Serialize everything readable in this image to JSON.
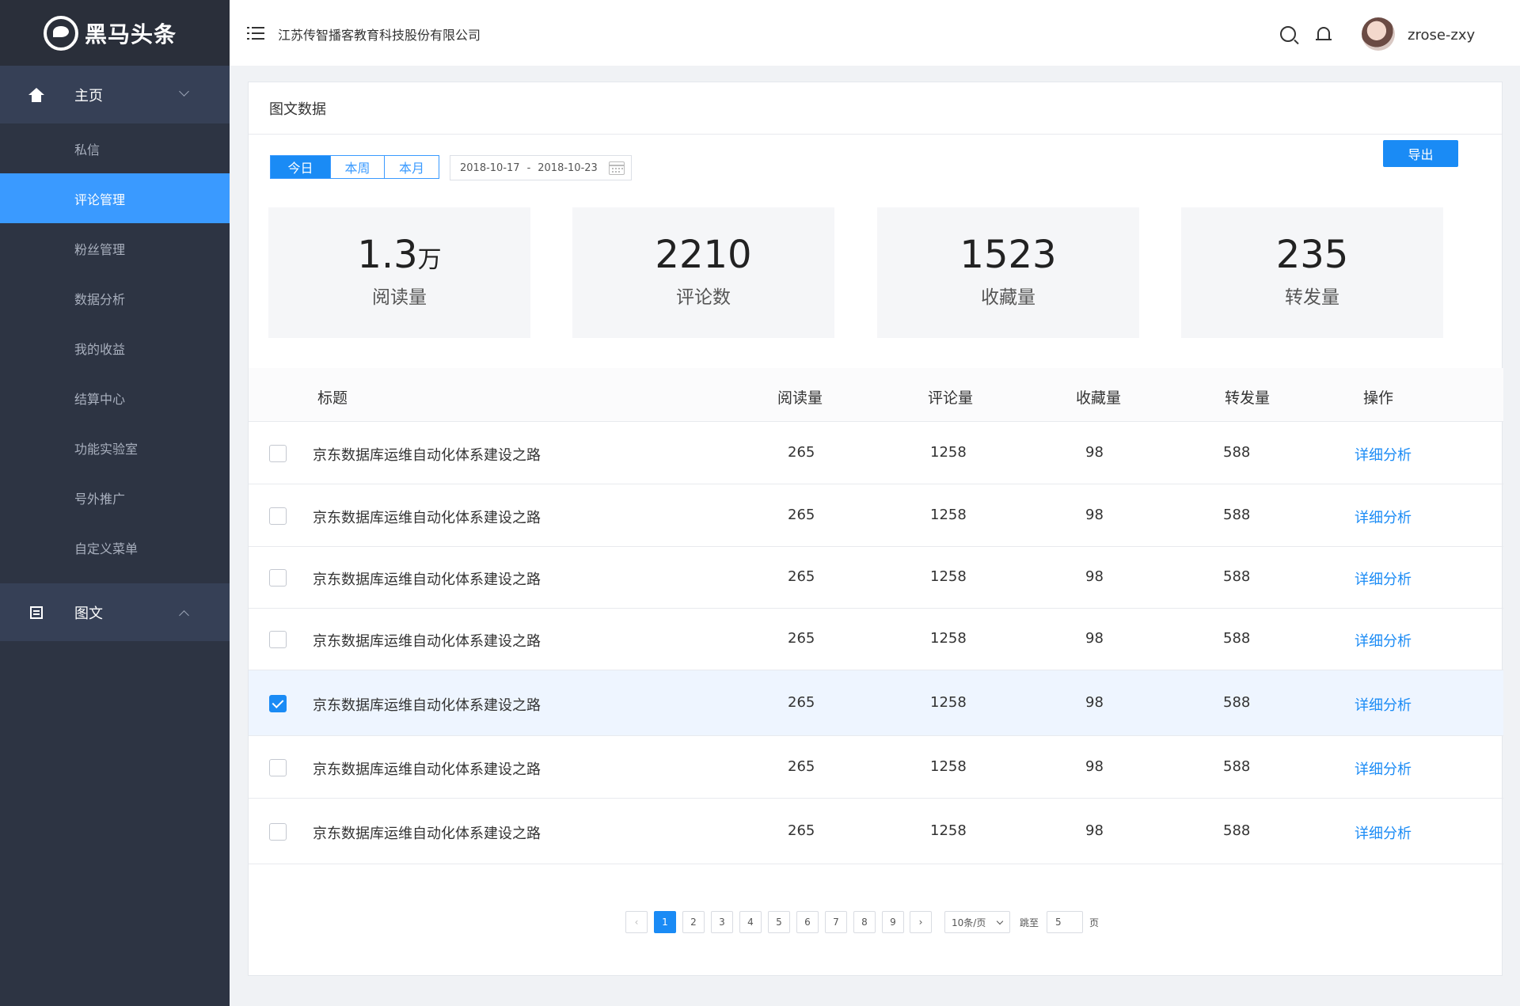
{
  "brand": {
    "name": "黑马头条"
  },
  "sidebar": {
    "home": {
      "label": "主页",
      "icon": "home-icon"
    },
    "items": [
      {
        "label": "私信"
      },
      {
        "label": "评论管理",
        "active": true
      },
      {
        "label": "粉丝管理"
      },
      {
        "label": "数据分析"
      },
      {
        "label": "我的收益"
      },
      {
        "label": "结算中心"
      },
      {
        "label": "功能实验室"
      },
      {
        "label": "号外推广"
      },
      {
        "label": "自定义菜单"
      }
    ],
    "tuwen": {
      "label": "图文",
      "icon": "document-icon"
    }
  },
  "header": {
    "company": "江苏传智播客教育科技股份有限公司",
    "username": "zrose-zxy"
  },
  "panel": {
    "title": "图文数据",
    "tabs": [
      "今日",
      "本周",
      "本月"
    ],
    "active_tab": "今日",
    "date_start": "2018-10-17",
    "date_sep": "-",
    "date_end": "2018-10-23",
    "export_label": "导出"
  },
  "stats": [
    {
      "value": "1.3",
      "unit": "万",
      "label": "阅读量"
    },
    {
      "value": "2210",
      "unit": "",
      "label": "评论数"
    },
    {
      "value": "1523",
      "unit": "",
      "label": "收藏量"
    },
    {
      "value": "235",
      "unit": "",
      "label": "转发量"
    }
  ],
  "table": {
    "columns": [
      "标题",
      "阅读量",
      "评论量",
      "收藏量",
      "转发量",
      "操作"
    ],
    "rows": [
      {
        "title": "京东数据库运维自动化体系建设之路",
        "reads": "265",
        "comments": "1258",
        "favorites": "98",
        "shares": "588",
        "action": "详细分析",
        "checked": false
      },
      {
        "title": "京东数据库运维自动化体系建设之路",
        "reads": "265",
        "comments": "1258",
        "favorites": "98",
        "shares": "588",
        "action": "详细分析",
        "checked": false
      },
      {
        "title": "京东数据库运维自动化体系建设之路",
        "reads": "265",
        "comments": "1258",
        "favorites": "98",
        "shares": "588",
        "action": "详细分析",
        "checked": false
      },
      {
        "title": "京东数据库运维自动化体系建设之路",
        "reads": "265",
        "comments": "1258",
        "favorites": "98",
        "shares": "588",
        "action": "详细分析",
        "checked": false
      },
      {
        "title": "京东数据库运维自动化体系建设之路",
        "reads": "265",
        "comments": "1258",
        "favorites": "98",
        "shares": "588",
        "action": "详细分析",
        "checked": true
      },
      {
        "title": "京东数据库运维自动化体系建设之路",
        "reads": "265",
        "comments": "1258",
        "favorites": "98",
        "shares": "588",
        "action": "详细分析",
        "checked": false
      },
      {
        "title": "京东数据库运维自动化体系建设之路",
        "reads": "265",
        "comments": "1258",
        "favorites": "98",
        "shares": "588",
        "action": "详细分析",
        "checked": false
      }
    ]
  },
  "pagination": {
    "pages": [
      "1",
      "2",
      "3",
      "4",
      "5",
      "6",
      "7",
      "8",
      "9"
    ],
    "current": "1",
    "prev": "‹",
    "next": "›",
    "page_size": "10条/页",
    "jump_label": "跳至",
    "jump_value": "5",
    "page_suffix": "页"
  },
  "colors": {
    "accent": "#1a8bf5",
    "sidebar": "#2d3443",
    "sidebar_active": "#3a9aff"
  }
}
